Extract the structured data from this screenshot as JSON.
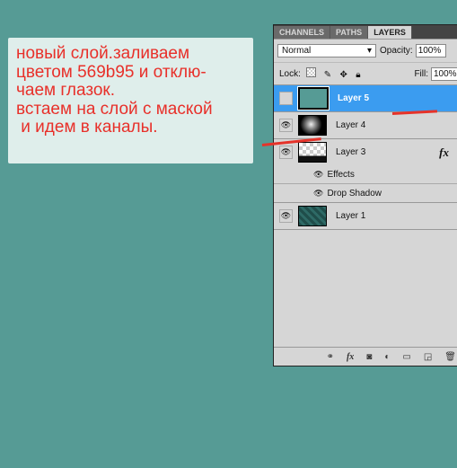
{
  "note": {
    "text": "новый слой.заливаем\nцветом 569b95 и отклю-\nчаем глазок.\nвстаем на слой с маской\n и идем в каналы."
  },
  "panel": {
    "tabs": [
      "CHANNELS",
      "PATHS",
      "LAYERS"
    ],
    "active_tab": "LAYERS",
    "blend_mode": "Normal",
    "opacity_label": "Opacity:",
    "opacity": "100%",
    "lock_label": "Lock:",
    "fill_label": "Fill:",
    "fill": "100%",
    "layers": [
      {
        "name": "Layer 5",
        "selected": true,
        "visible": false,
        "thumb_color": "#569b95"
      },
      {
        "name": "Layer 4",
        "visible": true
      },
      {
        "name": "Layer 3",
        "visible": true,
        "fx": "fx",
        "effects_label": "Effects",
        "effect": "Drop Shadow"
      },
      {
        "name": "Layer 1",
        "visible": true
      }
    ],
    "bottom_icons": [
      "link-icon",
      "fx-icon",
      "mask-icon",
      "adjustment-icon",
      "folder-icon",
      "new-layer-icon",
      "trash-icon"
    ]
  },
  "colors": {
    "background": "#569b95",
    "annotation": "#e8302a",
    "selection": "#3b9cf0"
  }
}
